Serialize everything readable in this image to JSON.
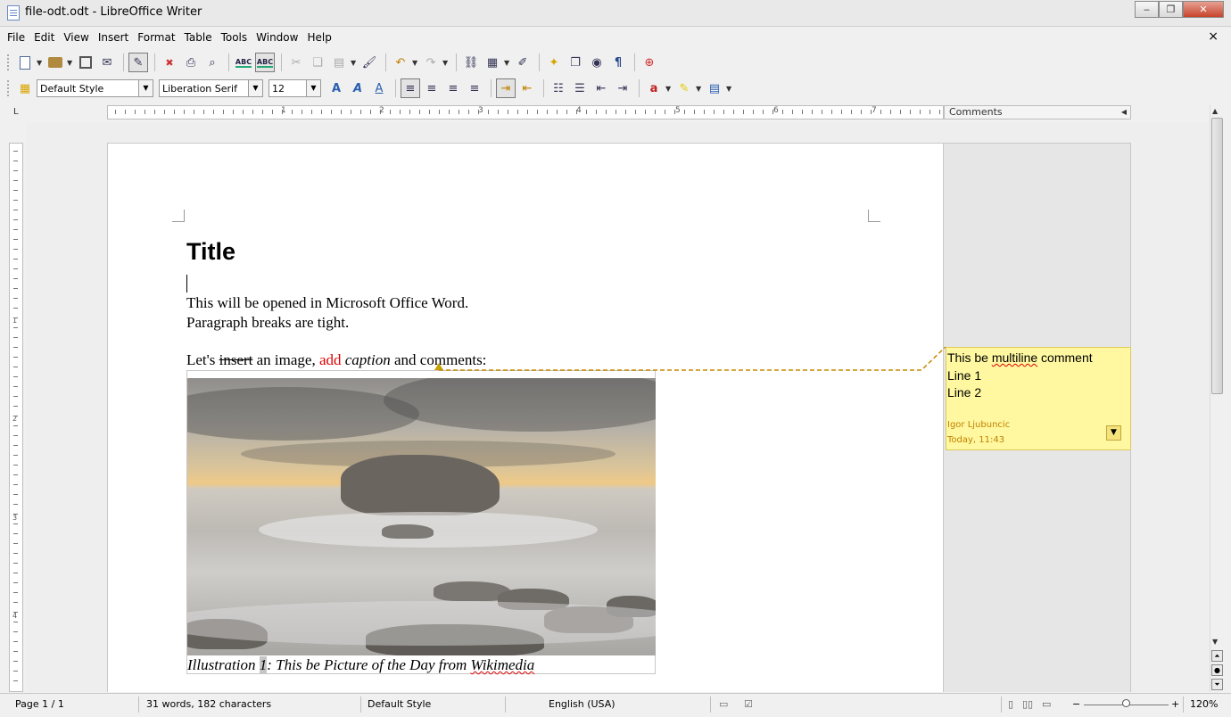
{
  "window": {
    "title": "file-odt.odt - LibreOffice Writer",
    "minimize": "‒",
    "maximize": "❐",
    "close": "✕"
  },
  "menu": [
    "File",
    "Edit",
    "View",
    "Insert",
    "Format",
    "Table",
    "Tools",
    "Window",
    "Help"
  ],
  "menu_close": "×",
  "toolbar": {
    "paragraph_style": "Default Style",
    "font_name": "Liberation Serif",
    "font_size": "12"
  },
  "ruler": {
    "numbers": [
      "1",
      "2",
      "3",
      "4",
      "5",
      "6",
      "7"
    ],
    "vertical_numbers": [
      "1",
      "2",
      "3",
      "4"
    ],
    "corner": "L",
    "comments_header": "Comments"
  },
  "document": {
    "title": "Title",
    "line1": "This will be opened in Microsoft Office Word.",
    "line2": "Paragraph breaks are tight.",
    "line3_a": "Let's ",
    "line3_strike": "insert",
    "line3_b": " an image, ",
    "line3_red": "add",
    "line3_c": " ",
    "line3_italic": "caption",
    "line3_d": " and comments:",
    "caption_a": "Illustration ",
    "caption_num": "1",
    "caption_b": ": This be Picture of the Day from ",
    "caption_link": "Wikimedia"
  },
  "comment": {
    "line0_a": "This be ",
    "line0_squiggle": "multiline",
    "line0_b": " comment",
    "line1": "Line 1",
    "line2": "Line 2",
    "author": "Igor Ljubuncic",
    "date": "Today, 11:43"
  },
  "status": {
    "page": "Page 1 / 1",
    "words": "31 words, 182 characters",
    "style": "Default Style",
    "language": "English (USA)",
    "zoom": "120%",
    "zoom_minus": "−",
    "zoom_plus": "+"
  },
  "colors": {
    "comment_bg": "#fff8a0",
    "comment_meta": "#c08000",
    "tracked_insert": "#e00000"
  }
}
